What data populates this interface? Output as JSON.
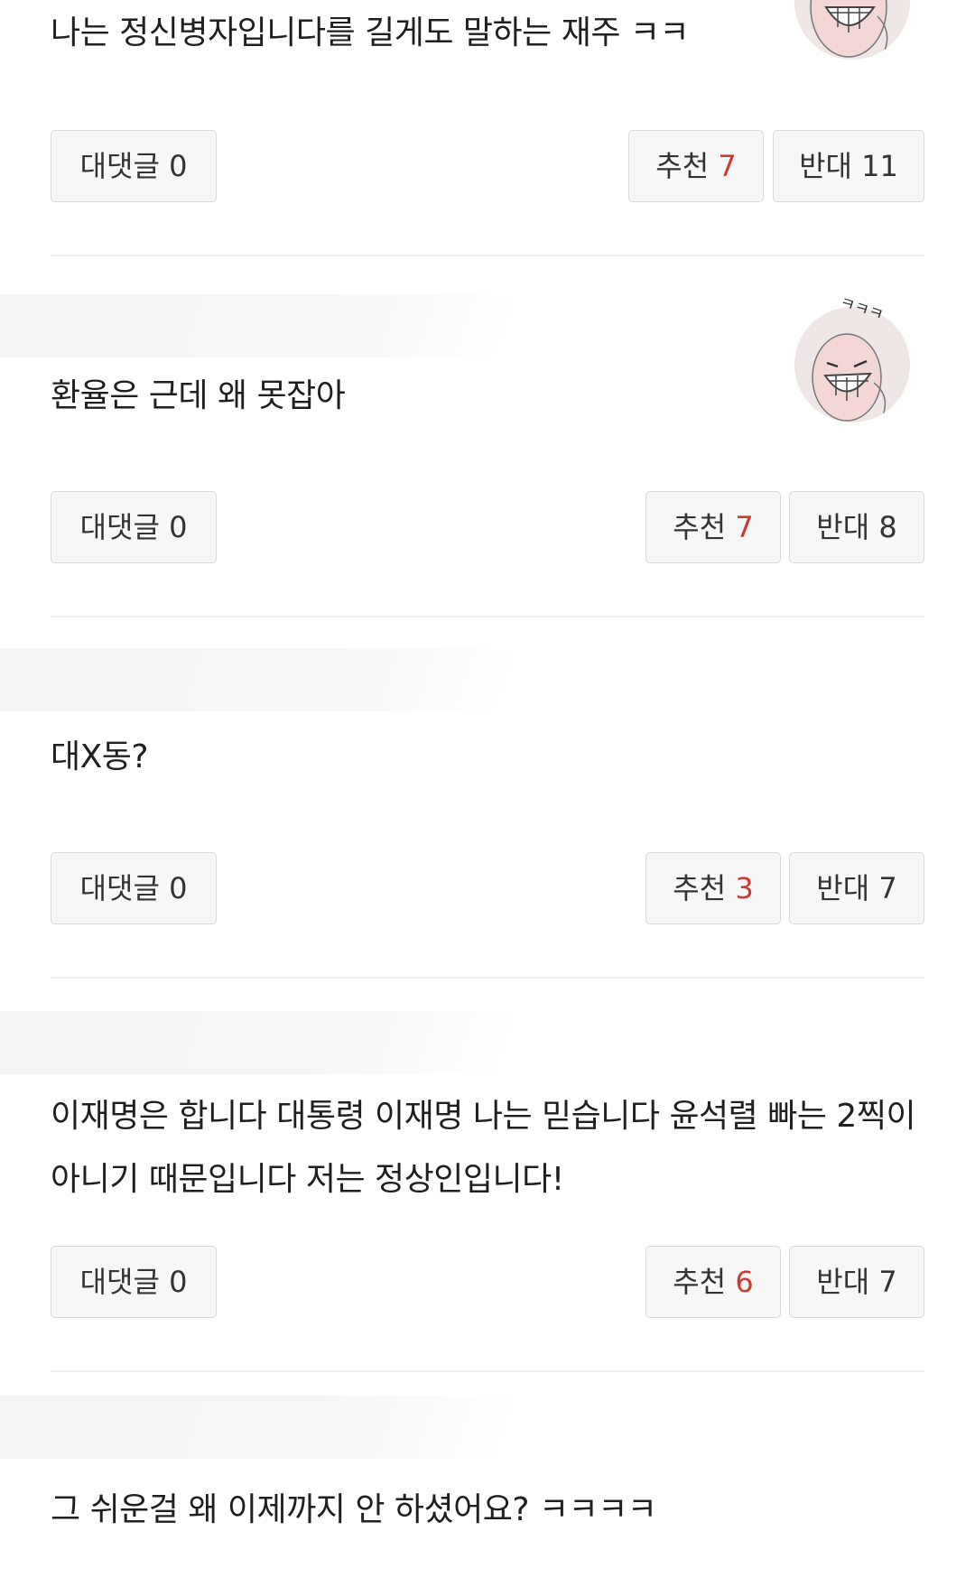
{
  "comments": [
    {
      "text": "나는 정신병자입니다를 길게도 말하는 재주 ㅋㅋ",
      "reply_label": "대댓글",
      "reply_count": "0",
      "recommend_label": "추천",
      "recommend_count": "7",
      "oppose_label": "반대",
      "oppose_count": "11",
      "has_avatar": true
    },
    {
      "text": "환율은 근데 왜 못잡아",
      "reply_label": "대댓글",
      "reply_count": "0",
      "recommend_label": "추천",
      "recommend_count": "7",
      "oppose_label": "반대",
      "oppose_count": "8",
      "has_avatar": true,
      "avatar_caption": "ㅋㅋㅋ"
    },
    {
      "text": "대X동?",
      "reply_label": "대댓글",
      "reply_count": "0",
      "recommend_label": "추천",
      "recommend_count": "3",
      "oppose_label": "반대",
      "oppose_count": "7",
      "has_avatar": false
    },
    {
      "text": "이재명은 합니다 대통령 이재명 나는 믿습니다 윤석렬 빠는 2찍이 아니기 때문입니다 저는 정상인입니다!",
      "reply_label": "대댓글",
      "reply_count": "0",
      "recommend_label": "추천",
      "recommend_count": "6",
      "oppose_label": "반대",
      "oppose_count": "7",
      "has_avatar": false
    },
    {
      "text": "그 쉬운걸 왜 이제까지 안 하셨어요? ㅋㅋㅋㅋ",
      "has_avatar": false
    }
  ],
  "colors": {
    "recommend_number": "#d0392f",
    "divider": "#eeeeee",
    "button_bg": "#f7f7f7",
    "button_border": "#d9d9d9"
  }
}
